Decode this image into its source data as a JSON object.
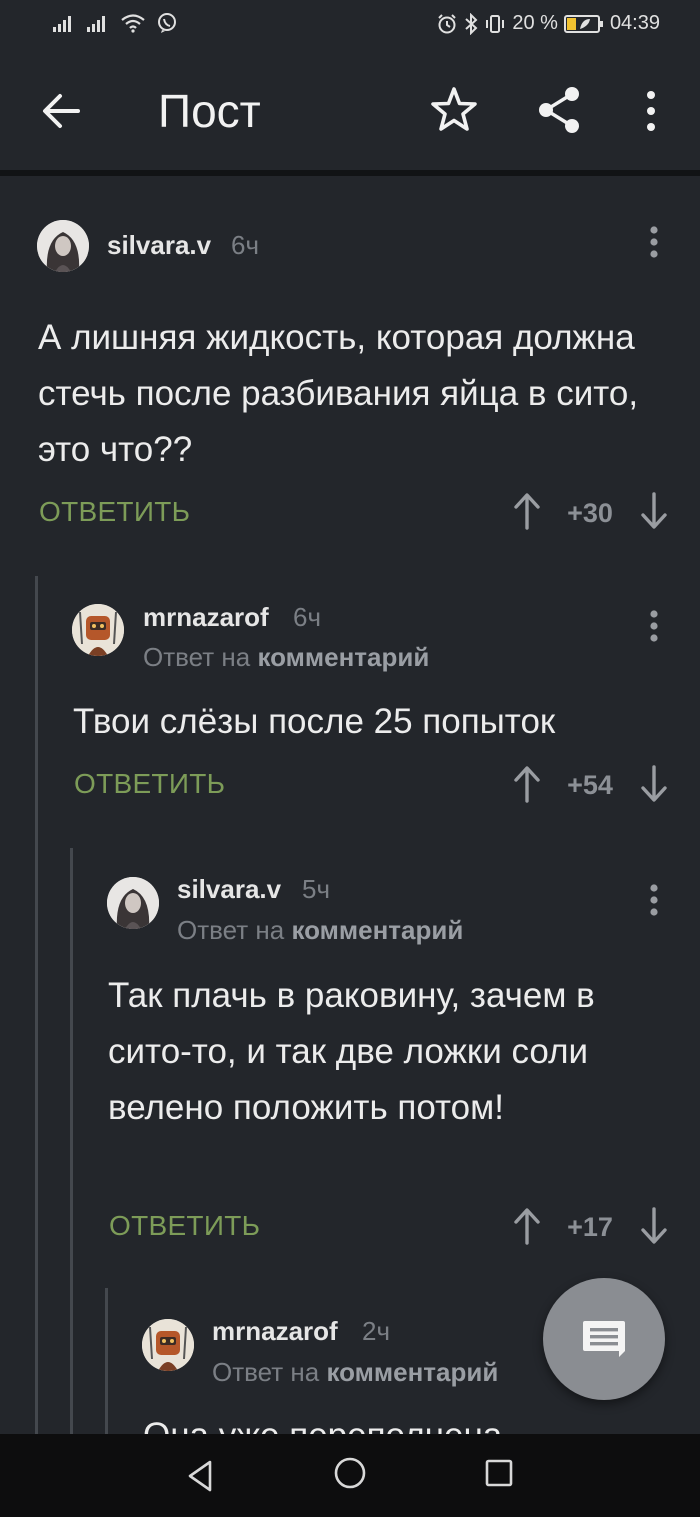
{
  "status_bar": {
    "battery_percent": "20 %",
    "time": "04:39"
  },
  "app_bar": {
    "title": "Пост"
  },
  "comments": [
    {
      "username": "silvara.v",
      "time": "6ч",
      "reply_to_prefix": "",
      "reply_to_target": "",
      "text": "А лишняя жидкость, которая должна стечь после разбивания яйца в сито, это что??",
      "reply_label": "ОТВЕТИТЬ",
      "score": "+30"
    },
    {
      "username": "mrnazarof",
      "time": "6ч",
      "reply_to_prefix": "Ответ на",
      "reply_to_target": "комментарий",
      "text": "Твои слёзы после 25 попыток",
      "reply_label": "ОТВЕТИТЬ",
      "score": "+54"
    },
    {
      "username": "silvara.v",
      "time": "5ч",
      "reply_to_prefix": "Ответ на",
      "reply_to_target": "комментарий",
      "text": "Так плачь в раковину, зачем в сито-то, и так две ложки соли велено положить потом!",
      "reply_label": "ОТВЕТИТЬ",
      "score": "+17"
    },
    {
      "username": "mrnazarof",
      "time": "2ч",
      "reply_to_prefix": "Ответ на",
      "reply_to_target": "комментарий",
      "text": "Она уже переполнена",
      "reply_label": "",
      "score": ""
    }
  ],
  "colors": {
    "background": "#23262b",
    "reply_green": "#7d9c58",
    "muted_text": "#7b7f85",
    "fab": "#8a8d92"
  },
  "icons": {
    "back": "arrow-left-icon",
    "favorite": "star-outline-icon",
    "share": "share-icon",
    "more": "more-vertical-icon",
    "upvote": "arrow-up-icon",
    "downvote": "arrow-down-icon",
    "fab": "comment-icon"
  }
}
